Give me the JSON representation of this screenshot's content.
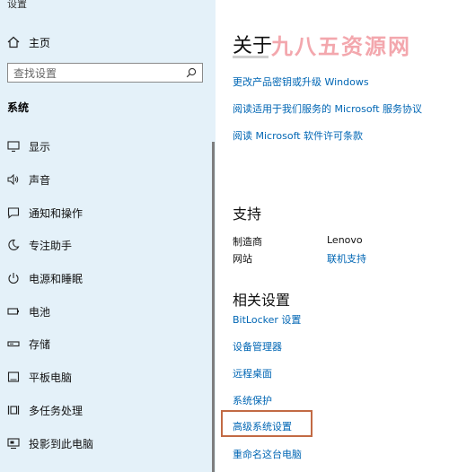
{
  "app": {
    "title": "设置"
  },
  "sidebar": {
    "home_label": "主页",
    "search_placeholder": "查找设置",
    "section_label": "系统",
    "items": [
      {
        "label": "显示",
        "icon": "display-icon"
      },
      {
        "label": "声音",
        "icon": "speaker-icon"
      },
      {
        "label": "通知和操作",
        "icon": "notification-icon"
      },
      {
        "label": "专注助手",
        "icon": "moon-icon"
      },
      {
        "label": "电源和睡眠",
        "icon": "power-icon"
      },
      {
        "label": "电池",
        "icon": "battery-icon"
      },
      {
        "label": "存储",
        "icon": "storage-icon"
      },
      {
        "label": "平板电脑",
        "icon": "tablet-icon"
      },
      {
        "label": "多任务处理",
        "icon": "multitask-icon"
      },
      {
        "label": "投影到此电脑",
        "icon": "projection-icon"
      }
    ]
  },
  "main": {
    "title": "关于",
    "watermark": "九八五资源网",
    "top_links": [
      "更改产品密钥或升级 Windows",
      "阅读适用于我们服务的 Microsoft 服务协议",
      "阅读 Microsoft 软件许可条款"
    ],
    "support": {
      "heading": "支持",
      "manufacturer_label": "制造商",
      "manufacturer_value": "Lenovo",
      "website_label": "网站",
      "website_value": "联机支持"
    },
    "related": {
      "heading": "相关设置",
      "links": [
        "BitLocker 设置",
        "设备管理器",
        "远程桌面",
        "系统保护",
        "高级系统设置",
        "重命名这台电脑"
      ]
    }
  },
  "colors": {
    "sidebar_bg": "#e4f1f9",
    "link": "#0066b4",
    "highlight_border": "#c26a44"
  }
}
